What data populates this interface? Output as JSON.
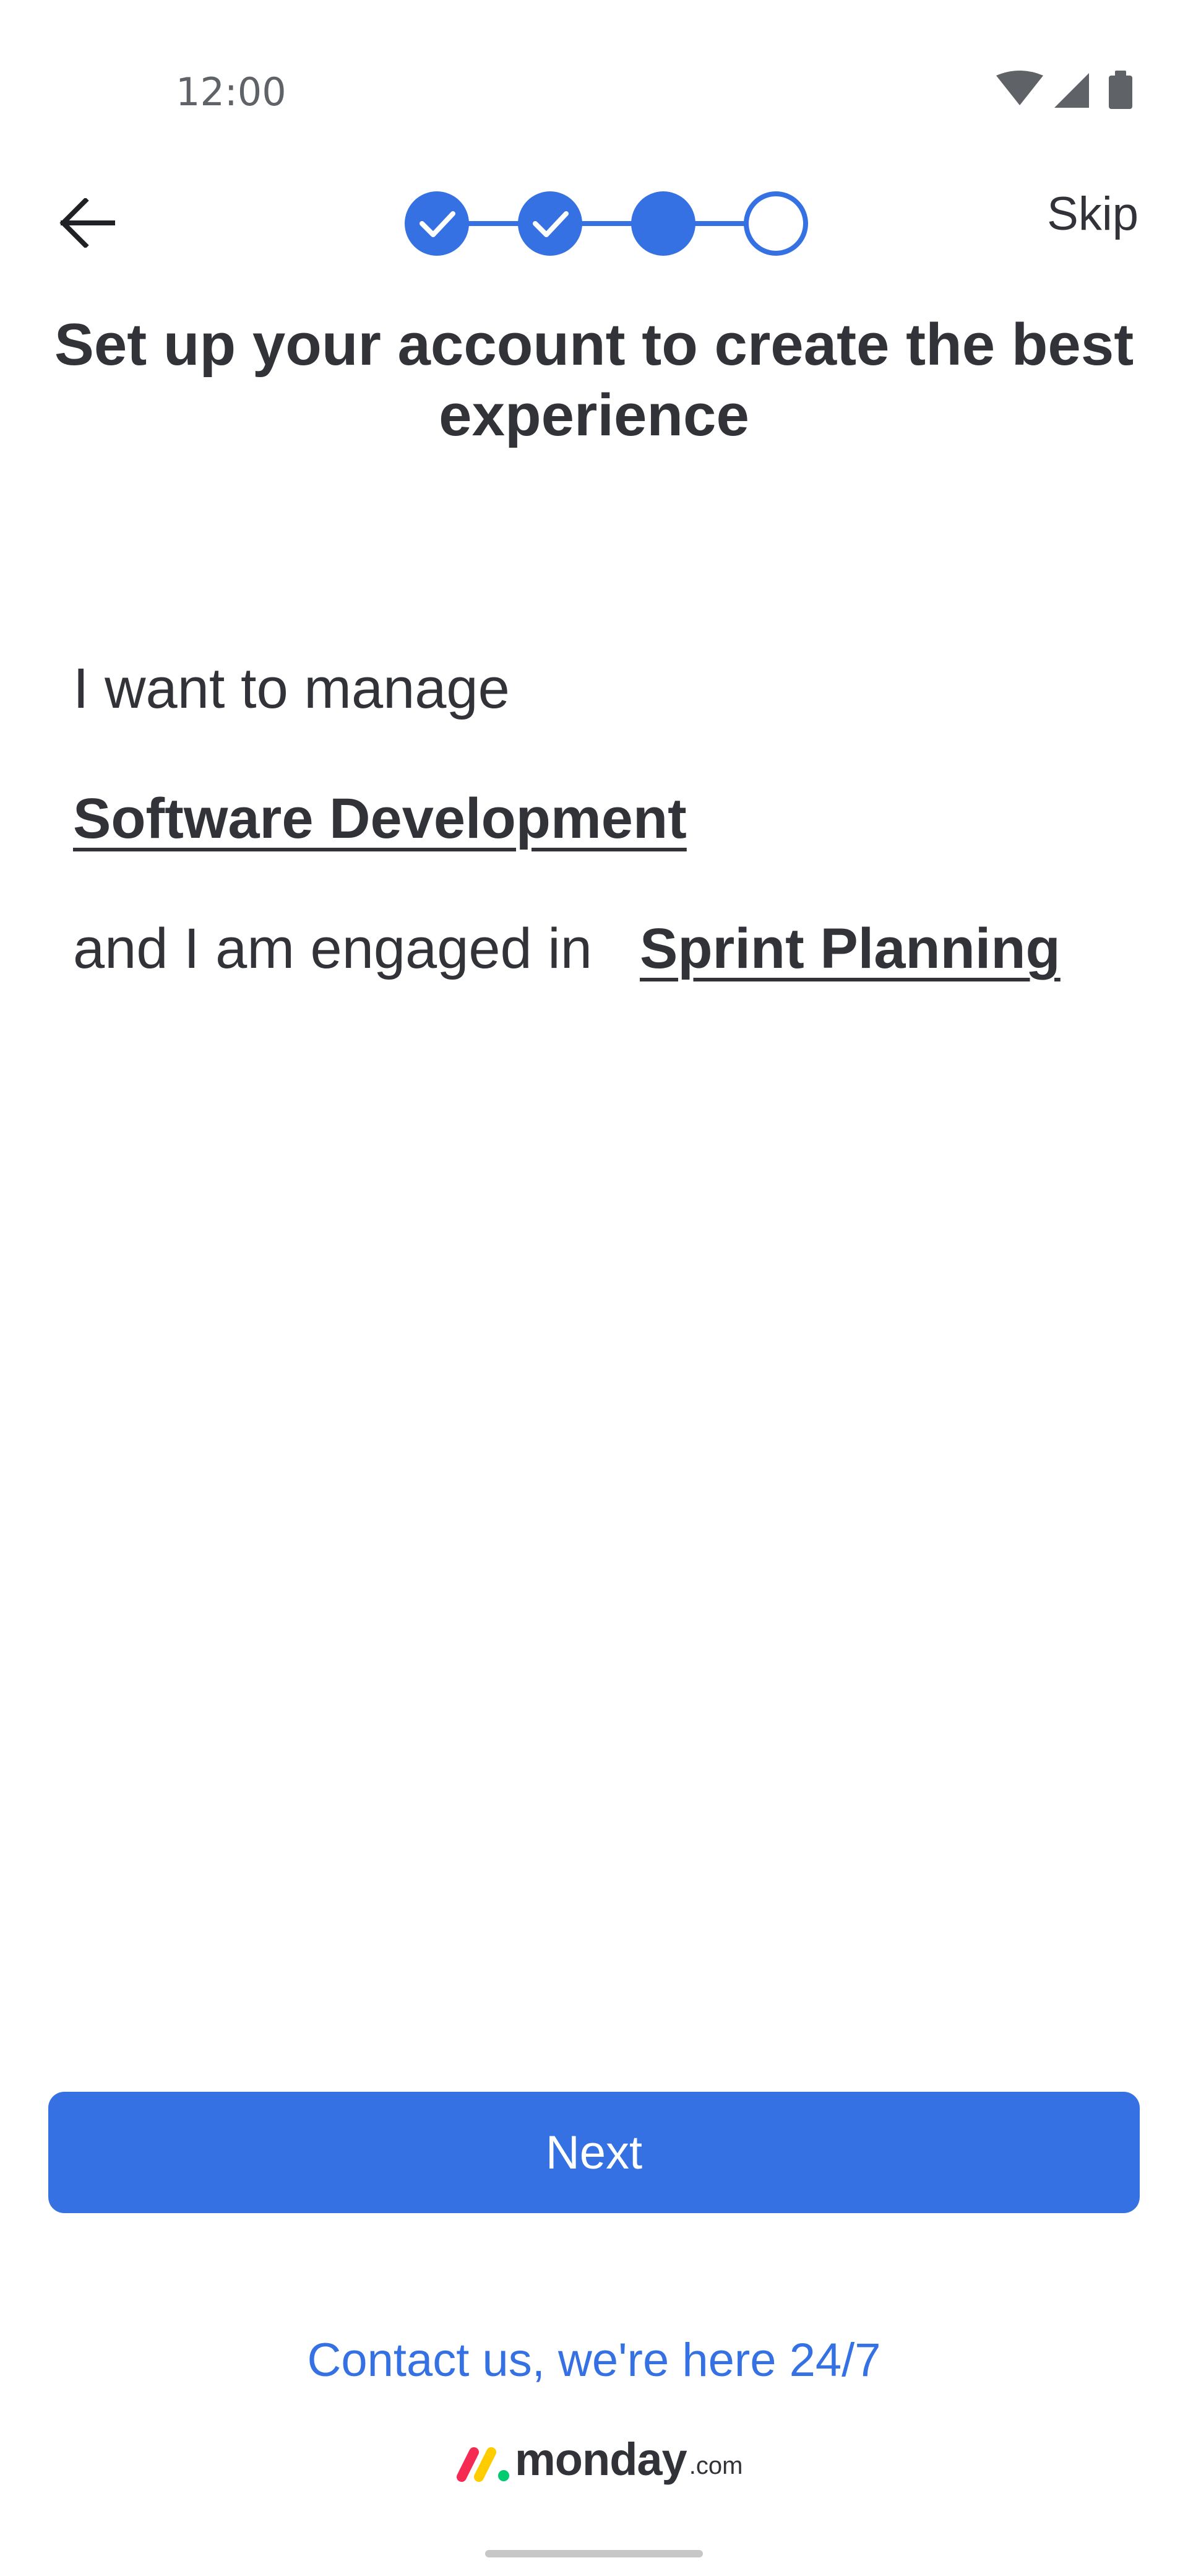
{
  "status_bar": {
    "time": "12:00",
    "icons": [
      "wifi-icon",
      "cellular-signal-icon",
      "battery-icon"
    ]
  },
  "top_bar": {
    "back_icon": "arrow-left-icon",
    "skip_label": "Skip",
    "stepper": {
      "steps": [
        {
          "state": "completed",
          "icon": "check-icon"
        },
        {
          "state": "completed",
          "icon": "check-icon"
        },
        {
          "state": "current"
        },
        {
          "state": "upcoming"
        }
      ],
      "active_color": "#3571e3"
    }
  },
  "title": "Set up your account to create the best experience",
  "form": {
    "line1": "I want to manage",
    "manage_value": "Software Development",
    "line2": "and I am engaged in",
    "engaged_value": "Sprint Planning"
  },
  "next_button": {
    "label": "Next",
    "color": "#3571e3"
  },
  "contact_link": "Contact us, we're here 24/7",
  "logo": {
    "word": "monday",
    "tld": ".com",
    "mark_colors": [
      "#f62b54",
      "#ffcc00",
      "#00ca72"
    ]
  }
}
